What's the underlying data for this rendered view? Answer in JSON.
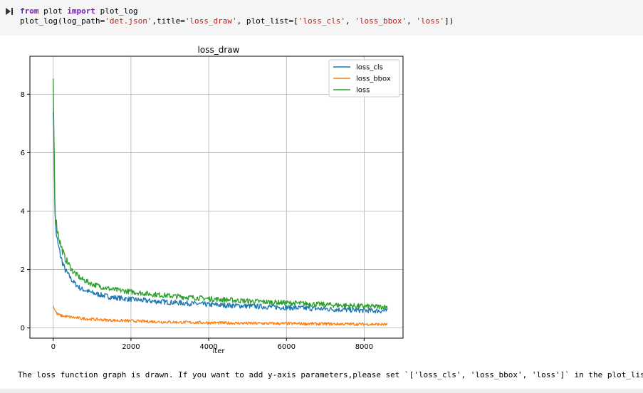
{
  "cell": {
    "code_line1_kw_from": "from",
    "code_line1_module": " plot ",
    "code_line1_kw_import": "import",
    "code_line1_name": " plot_log",
    "code_line2_fn": "plot_log(log_path=",
    "code_line2_path": "'det.json'",
    "code_line2_mid": ",title=",
    "code_line2_title": "'loss_draw'",
    "code_line2_list_kw": ", plot_list=[",
    "code_line2_item1": "'loss_cls'",
    "code_line2_sep1": ", ",
    "code_line2_item2": "'loss_bbox'",
    "code_line2_sep2": ", ",
    "code_line2_item3": "'loss'",
    "code_line2_end": "])"
  },
  "markdown": {
    "text": "The loss function graph is drawn. If you want to add y-axis parameters,please set `['loss_cls', 'loss_bbox', 'loss']` in the plot_list"
  },
  "chart_data": {
    "type": "line",
    "title": "loss_draw",
    "xlabel": "iter",
    "ylabel": "",
    "xlim": [
      -600,
      9000
    ],
    "ylim": [
      -0.35,
      9.3
    ],
    "xticks": [
      0,
      2000,
      4000,
      6000,
      8000
    ],
    "yticks": [
      0,
      2,
      4,
      6,
      8
    ],
    "grid": true,
    "legend": "top-right",
    "series": [
      {
        "name": "loss_cls",
        "color": "#1f77b4",
        "x": [
          0,
          20,
          50,
          100,
          200,
          300,
          500,
          700,
          1000,
          1500,
          2000,
          2500,
          3000,
          3500,
          4000,
          5000,
          6000,
          7000,
          8000,
          8600
        ],
        "y": [
          7.8,
          6.0,
          3.6,
          3.0,
          2.4,
          2.0,
          1.6,
          1.35,
          1.2,
          1.05,
          0.98,
          0.92,
          0.88,
          0.84,
          0.8,
          0.75,
          0.7,
          0.65,
          0.6,
          0.58
        ]
      },
      {
        "name": "loss_bbox",
        "color": "#ff7f0e",
        "x": [
          0,
          50,
          100,
          200,
          400,
          700,
          1000,
          1500,
          2000,
          3000,
          4000,
          5000,
          6000,
          7000,
          8000,
          8600
        ],
        "y": [
          0.75,
          0.6,
          0.48,
          0.42,
          0.38,
          0.33,
          0.3,
          0.26,
          0.24,
          0.2,
          0.18,
          0.16,
          0.15,
          0.14,
          0.13,
          0.12
        ]
      },
      {
        "name": "loss",
        "color": "#2ca02c",
        "x": [
          0,
          20,
          50,
          100,
          200,
          300,
          500,
          700,
          1000,
          1500,
          2000,
          2500,
          3000,
          3500,
          4000,
          5000,
          6000,
          7000,
          8000,
          8600
        ],
        "y": [
          8.4,
          6.5,
          3.9,
          3.4,
          2.8,
          2.4,
          1.95,
          1.7,
          1.5,
          1.32,
          1.24,
          1.16,
          1.1,
          1.05,
          1.0,
          0.92,
          0.86,
          0.8,
          0.74,
          0.72
        ]
      }
    ]
  }
}
